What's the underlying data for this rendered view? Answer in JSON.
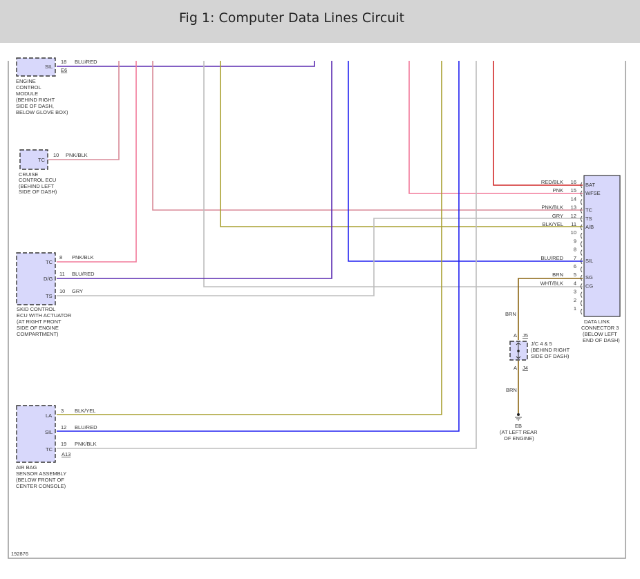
{
  "title": "Fig 1: Computer Data Lines Circuit",
  "diagram_id": "192876",
  "colors": {
    "pink": "#f27a9a",
    "red": "#d02828",
    "blue": "#2020f0",
    "blu_red": "#5a2ab0",
    "gray": "#bdbdbd",
    "blk_yel": "#a8a030",
    "brn": "#8a6410",
    "component_fill": "#d8d8fb"
  },
  "ecm": {
    "pin_label": "SIL",
    "pin": "18",
    "wire": "BLU/RED",
    "connector": "E6",
    "name": [
      "ENGINE",
      "CONTROL",
      "MODULE",
      "(BEHIND RIGHT",
      "SIDE OF DASH,",
      "BELOW GLOVE BOX)"
    ]
  },
  "cruise": {
    "pin_label": "TC",
    "pin": "10",
    "wire": "PNK/BLK",
    "name": [
      "CRUISE",
      "CONTROL ECU",
      "(BEHIND LEFT",
      "SIDE OF DASH)"
    ]
  },
  "skid": {
    "pins": [
      {
        "label": "TC",
        "num": "8",
        "wire": "PNK/BLK"
      },
      {
        "label": "D/G",
        "num": "11",
        "wire": "BLU/RED"
      },
      {
        "label": "TS",
        "num": "10",
        "wire": "GRY"
      }
    ],
    "name": [
      "SKID CONTROL",
      "ECU WITH ACTUATOR",
      "(AT RIGHT FRONT",
      "SIDE OF ENGINE",
      "COMPARTMENT)"
    ]
  },
  "airbag": {
    "pins": [
      {
        "label": "LA",
        "num": "3",
        "wire": "BLK/YEL"
      },
      {
        "label": "SIL",
        "num": "12",
        "wire": "BLU/RED"
      },
      {
        "label": "TC",
        "num": "19",
        "wire": "PNK/BLK"
      }
    ],
    "connector": "A13",
    "name": [
      "AIR BAG",
      "SENSOR ASSEMBLY",
      "(BELOW FRONT OF",
      "CENTER CONSOLE)"
    ]
  },
  "dlc": {
    "pins": [
      {
        "num": "16",
        "label": "BAT",
        "wire": "RED/BLK"
      },
      {
        "num": "15",
        "label": "WFSE",
        "wire": "PNK"
      },
      {
        "num": "14",
        "label": "",
        "wire": ""
      },
      {
        "num": "13",
        "label": "TC",
        "wire": "PNK/BLK"
      },
      {
        "num": "12",
        "label": "TS",
        "wire": "GRY"
      },
      {
        "num": "11",
        "label": "A/B",
        "wire": "BLK/YEL"
      },
      {
        "num": "10",
        "label": "",
        "wire": ""
      },
      {
        "num": "9",
        "label": "",
        "wire": ""
      },
      {
        "num": "8",
        "label": "",
        "wire": ""
      },
      {
        "num": "7",
        "label": "SIL",
        "wire": "BLU/RED"
      },
      {
        "num": "6",
        "label": "",
        "wire": ""
      },
      {
        "num": "5",
        "label": "SG",
        "wire": "BRN"
      },
      {
        "num": "4",
        "label": "CG",
        "wire": "WHT/BLK"
      },
      {
        "num": "3",
        "label": "",
        "wire": ""
      },
      {
        "num": "2",
        "label": "",
        "wire": ""
      },
      {
        "num": "1",
        "label": "",
        "wire": ""
      }
    ],
    "name": [
      "DATA LINK",
      "CONNECTOR 3",
      "(BELOW LEFT",
      "END OF DASH)"
    ]
  },
  "jc": {
    "top_pin": "A",
    "top_conn": "J5",
    "bottom_pin": "A",
    "bottom_conn": "J4",
    "wire_top": "BRN",
    "wire_bottom": "BRN",
    "name": [
      "J/C 4 & 5",
      "(BEHIND RIGHT",
      "SIDE OF DASH)"
    ]
  },
  "ground": {
    "name": [
      "EB",
      "(AT LEFT REAR",
      "OF ENGINE)"
    ]
  }
}
